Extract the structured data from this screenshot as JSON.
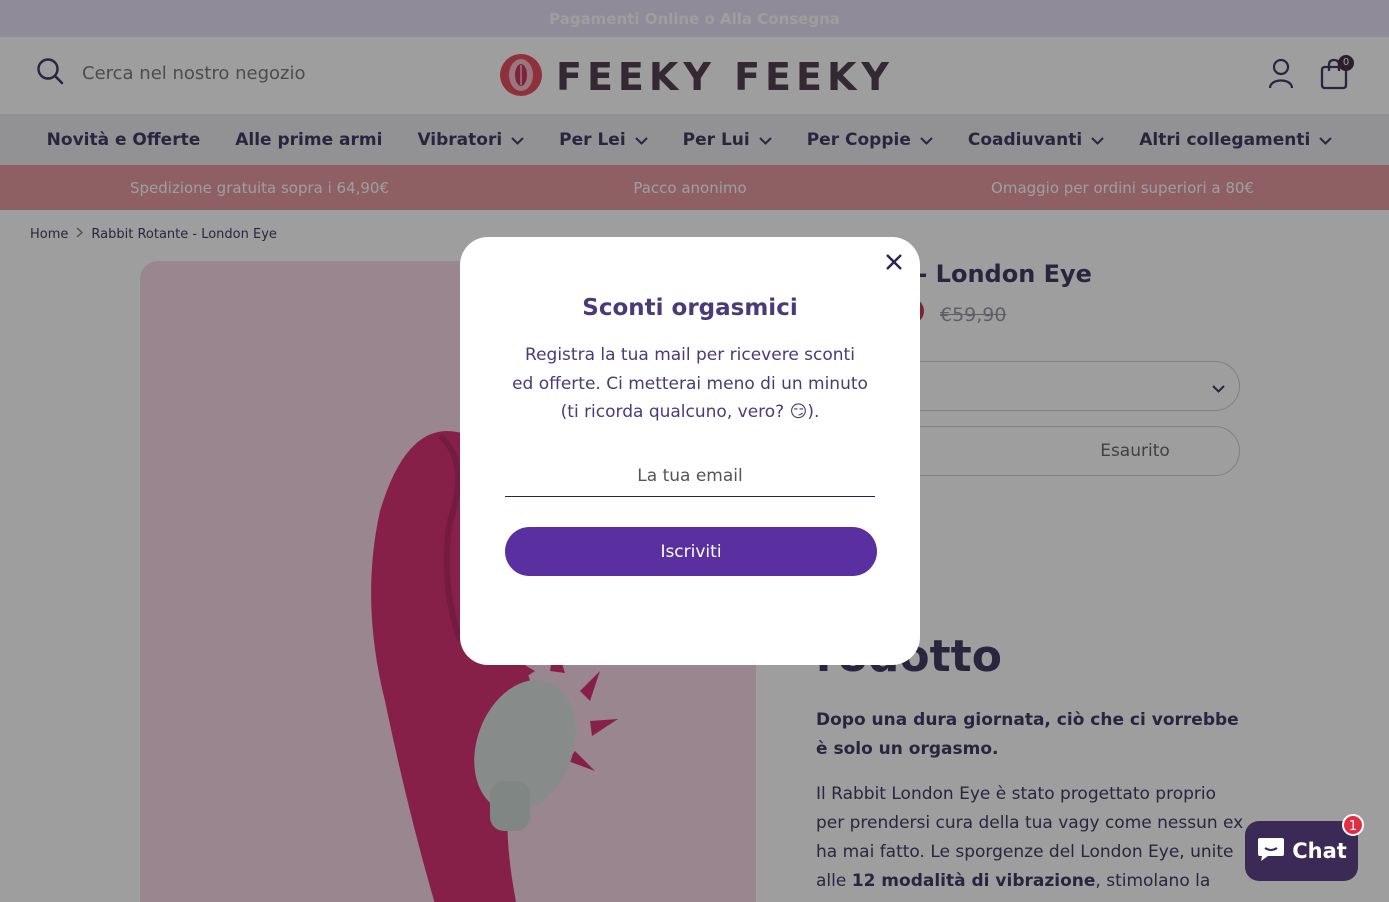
{
  "announcement": {
    "text": "Pagamenti Online o Alla Consegna"
  },
  "header": {
    "search_placeholder": "Cerca nel nostro negozio",
    "logo_text": "FEEKY FEEKY",
    "cart_count": "0"
  },
  "nav": {
    "items": [
      {
        "label": "Novità e Offerte",
        "dropdown": false
      },
      {
        "label": "Alle prime armi",
        "dropdown": false
      },
      {
        "label": "Vibratori",
        "dropdown": true
      },
      {
        "label": "Per Lei",
        "dropdown": true
      },
      {
        "label": "Per Lui",
        "dropdown": true
      },
      {
        "label": "Per Coppie",
        "dropdown": true
      },
      {
        "label": "Coadiuvanti",
        "dropdown": true
      },
      {
        "label": "Altri collegamenti",
        "dropdown": true
      }
    ]
  },
  "usp": {
    "items": [
      "Spedizione gratuita sopra i 64,90€",
      "Pacco anonimo",
      "Omaggio per ordini superiori a 80€"
    ]
  },
  "breadcrumb": {
    "home": "Home",
    "current": "Rabbit Rotante - London Eye"
  },
  "product": {
    "title_visible": "otante - London Eye",
    "price_old": "€59,90",
    "soldout_label": "Esaurito",
    "desc_heading_visible": "rodotto",
    "desc_lead": "Dopo una dura giornata, ciò che ci vorrebbe è solo un orgasmo.",
    "desc_part1": "Il Rabbit London Eye è stato progettato proprio per prendersi cura della tua vagy come nessun ex ha mai fatto. Le sporgenze del London Eye, unite alle ",
    "desc_bold1": "12 modalità di vibrazione",
    "desc_part2": ", stimolano la parete vaginale"
  },
  "modal": {
    "title": "Sconti orgasmici",
    "text": "Registra la tua mail per ricevere sconti ed offerte. Ci metterai meno di un minuto (ti ricorda qualcuno, vero? 😏).",
    "email_placeholder": "La tua email",
    "submit_label": "Iscriviti"
  },
  "chat": {
    "label": "Chat",
    "badge": "1"
  },
  "colors": {
    "announcement_bg": "#e3dcf4",
    "usp_bg": "#e28f96",
    "brand_dark": "#2d2352",
    "button_purple": "#5a2fa0",
    "chat_bg": "#3b2a55",
    "badge_red": "#e32d43"
  },
  "icons": [
    "search-icon",
    "logo-icon",
    "account-icon",
    "cart-icon",
    "chevron-down-icon",
    "chevron-right-icon",
    "close-icon",
    "chat-icon"
  ]
}
